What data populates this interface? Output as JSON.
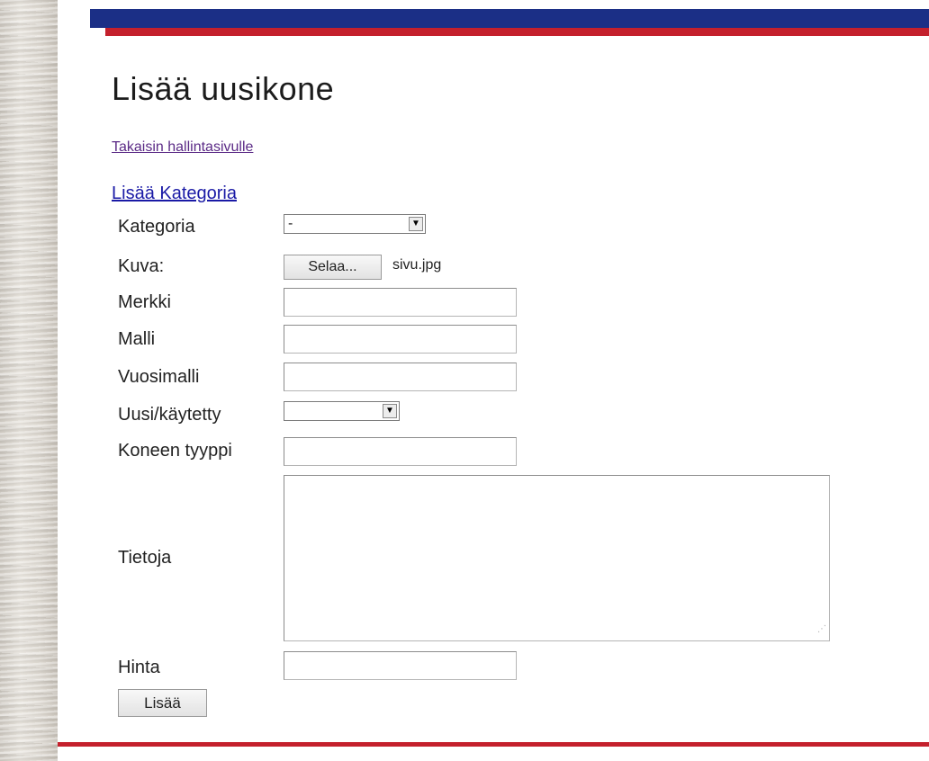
{
  "header": {
    "title": "Lisää uusikone"
  },
  "links": {
    "back": "Takaisin hallintasivulle",
    "add_category": "Lisää Kategoria"
  },
  "form": {
    "category": {
      "label": "Kategoria",
      "selected": "-"
    },
    "image": {
      "label": "Kuva:",
      "browse_button": "Selaa...",
      "file_name": "sivu.jpg"
    },
    "brand": {
      "label": "Merkki",
      "value": ""
    },
    "model": {
      "label": "Malli",
      "value": ""
    },
    "model_year": {
      "label": "Vuosimalli",
      "value": ""
    },
    "condition": {
      "label": "Uusi/käytetty",
      "selected": ""
    },
    "machine_type": {
      "label": "Koneen tyyppi",
      "value": ""
    },
    "details": {
      "label": "Tietoja",
      "value": ""
    },
    "price": {
      "label": "Hinta",
      "value": ""
    },
    "submit_label": "Lisää"
  },
  "icons": {
    "dropdown": "chevron-down-icon",
    "resize": "resize-grip-icon"
  },
  "colors": {
    "header_blue": "#1b2f86",
    "header_red": "#c4202c",
    "link_visited": "#5b2a86",
    "link": "#1a1aa6"
  }
}
